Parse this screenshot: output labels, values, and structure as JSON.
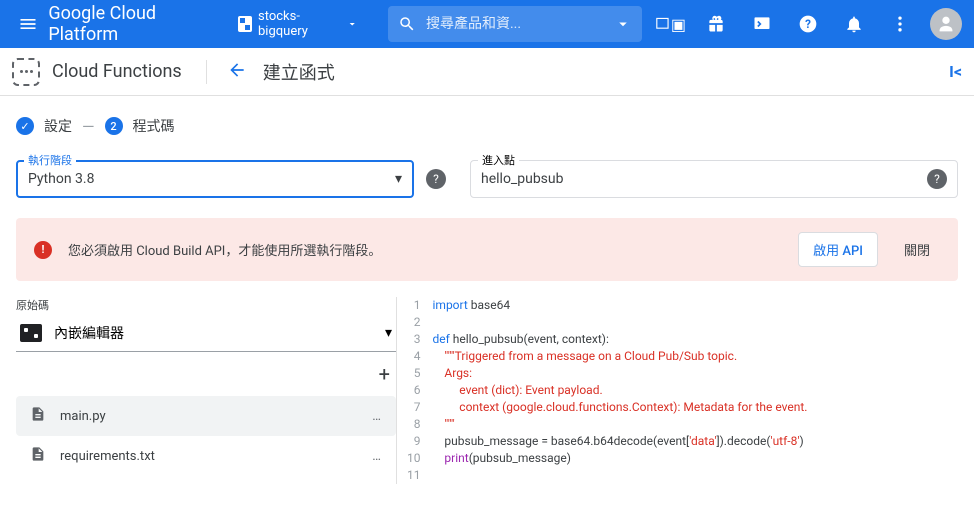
{
  "header": {
    "logo": "Google Cloud Platform",
    "project": "stocks-bigquery",
    "search_placeholder": "搜尋產品和資..."
  },
  "subheader": {
    "service": "Cloud Functions",
    "page_title": "建立函式"
  },
  "stepper": {
    "step1_label": "設定",
    "step2_num": "2",
    "step2_label": "程式碼"
  },
  "fields": {
    "runtime_label": "執行階段",
    "runtime_value": "Python 3.8",
    "entry_label": "進入點",
    "entry_value": "hello_pubsub"
  },
  "alert": {
    "message": "您必須啟用 Cloud Build API，才能使用所選執行階段。",
    "enable_btn": "啟用 API",
    "close_btn": "關閉"
  },
  "source": {
    "label": "原始碼",
    "value": "內嵌編輯器"
  },
  "files": [
    {
      "name": "main.py",
      "active": true
    },
    {
      "name": "requirements.txt",
      "active": false
    }
  ],
  "code_lines": [
    "import base64",
    "",
    "def hello_pubsub(event, context):",
    "    \"\"\"Triggered from a message on a Cloud Pub/Sub topic.",
    "    Args:",
    "         event (dict): Event payload.",
    "         context (google.cloud.functions.Context): Metadata for the event.",
    "    \"\"\"",
    "    pubsub_message = base64.b64decode(event['data']).decode('utf-8')",
    "    print(pubsub_message)",
    ""
  ]
}
